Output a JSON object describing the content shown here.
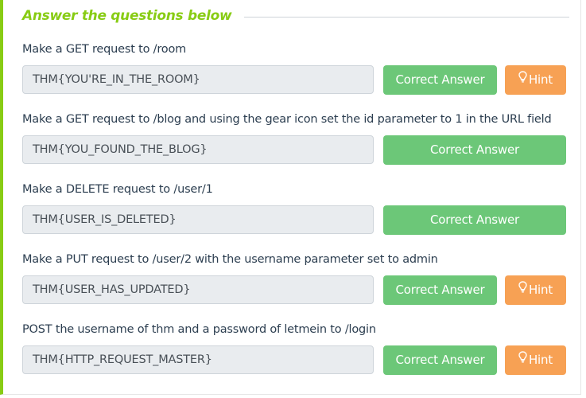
{
  "section": {
    "title": "Answer the questions below"
  },
  "questions": [
    {
      "text": "Make a GET request to /room",
      "answer": "THM{YOU'RE_IN_THE_ROOM}",
      "correct_label": "Correct Answer",
      "hint_label": "Hint"
    },
    {
      "text": "Make a GET request to /blog and using the gear icon set the id parameter to 1 in the URL field",
      "answer": "THM{YOU_FOUND_THE_BLOG}",
      "correct_label": "Correct Answer"
    },
    {
      "text": "Make a DELETE request to /user/1",
      "answer": "THM{USER_IS_DELETED}",
      "correct_label": "Correct Answer"
    },
    {
      "text": "Make a PUT request to /user/2 with the username parameter set to admin",
      "answer": "THM{USER_HAS_UPDATED}",
      "correct_label": "Correct Answer",
      "hint_label": "Hint"
    },
    {
      "text": "POST the username of thm and a password of letmein to /login",
      "answer": "THM{HTTP_REQUEST_MASTER}",
      "correct_label": "Correct Answer",
      "hint_label": "Hint"
    }
  ],
  "colors": {
    "accent": "#88cc14",
    "correct_button": "#6cc778",
    "hint_button": "#f7a154",
    "answer_bg": "#e9ecef"
  },
  "icons": {
    "hint": "lightbulb-icon"
  }
}
